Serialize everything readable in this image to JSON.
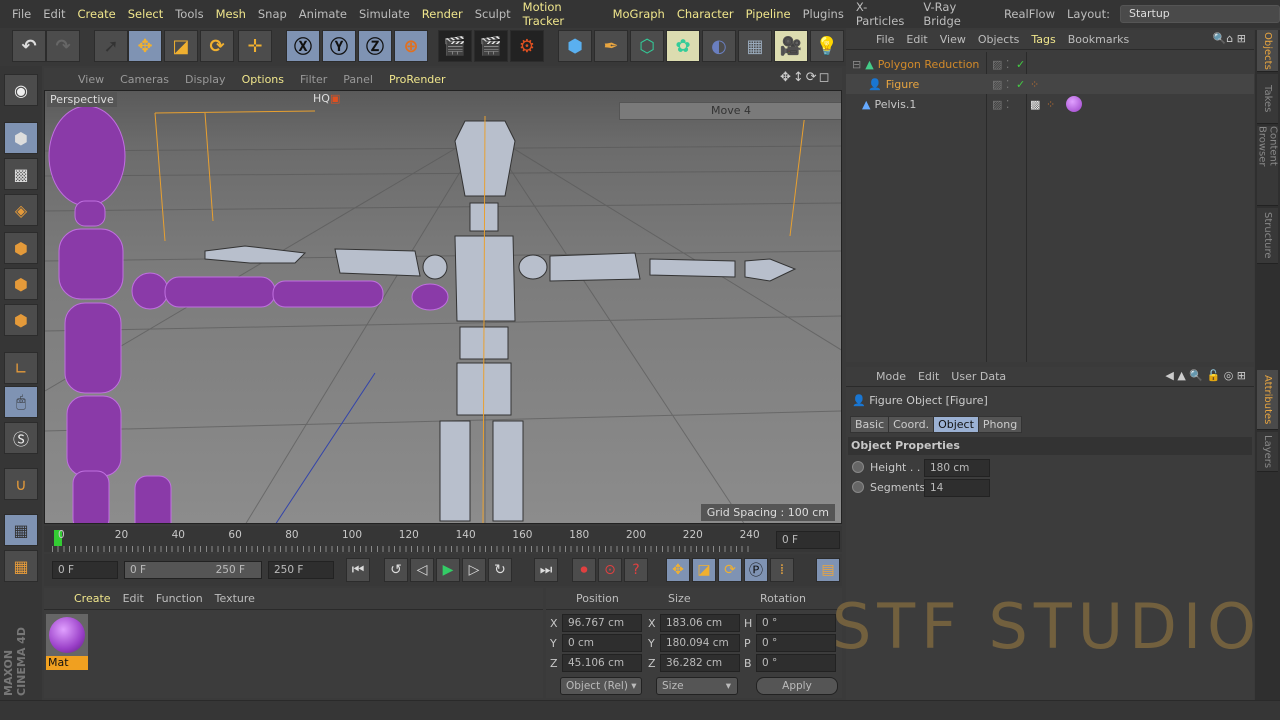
{
  "menubar": {
    "items": [
      "File",
      "Edit",
      "Create",
      "Select",
      "Tools",
      "Mesh",
      "Snap",
      "Animate",
      "Simulate",
      "Render",
      "Sculpt",
      "Motion Tracker",
      "MoGraph",
      "Character",
      "Pipeline",
      "Plugins",
      "X-Particles",
      "V-Ray Bridge",
      "RealFlow"
    ],
    "highlighted": [
      2,
      3,
      5,
      9,
      11,
      12,
      13,
      14
    ],
    "layout_label": "Layout:",
    "layout_value": "Startup"
  },
  "viewport": {
    "menu": [
      "View",
      "Cameras",
      "Display",
      "Options",
      "Filter",
      "Panel",
      "ProRender"
    ],
    "camera": "Perspective",
    "hq": "HQ",
    "move_hud": "Move 4",
    "grid_spacing": "Grid Spacing : 100 cm"
  },
  "timeline": {
    "ticks": [
      "0",
      "20",
      "40",
      "60",
      "80",
      "100",
      "120",
      "140",
      "160",
      "180",
      "200",
      "220",
      "240"
    ],
    "current": "0 F",
    "start": "0 F",
    "range_start": "0 F",
    "range_end": "250 F",
    "end": "250 F"
  },
  "materials": {
    "menu": [
      "Create",
      "Edit",
      "Function",
      "Texture"
    ],
    "items": [
      {
        "name": "Mat",
        "color": "#b15ee0"
      }
    ]
  },
  "coords": {
    "headers": [
      "Position",
      "Size",
      "Rotation"
    ],
    "rows": [
      {
        "pl": "X",
        "p": "96.767 cm",
        "sl": "X",
        "s": "183.06 cm",
        "rl": "H",
        "r": "0 °"
      },
      {
        "pl": "Y",
        "p": "0 cm",
        "sl": "Y",
        "s": "180.094 cm",
        "rl": "P",
        "r": "0 °"
      },
      {
        "pl": "Z",
        "p": "45.106 cm",
        "sl": "Z",
        "s": "36.282 cm",
        "rl": "B",
        "r": "0 °"
      }
    ],
    "mode": "Object (Rel)",
    "size_mode": "Size",
    "apply": "Apply"
  },
  "objects": {
    "menu": [
      "File",
      "Edit",
      "View",
      "Objects",
      "Tags",
      "Bookmarks"
    ],
    "items": [
      {
        "name": "Polygon Reduction",
        "color": "#d28a2a"
      },
      {
        "name": "Figure",
        "color": "#e8a540"
      },
      {
        "name": "Pelvis.1",
        "color": "#c8c8c8"
      }
    ]
  },
  "attributes": {
    "menu": [
      "Mode",
      "Edit",
      "User Data"
    ],
    "title": "Figure Object [Figure]",
    "tabs": [
      "Basic",
      "Coord.",
      "Object",
      "Phong"
    ],
    "active_tab": "Object",
    "section": "Object Properties",
    "props": [
      {
        "label": "Height . .",
        "value": "180 cm"
      },
      {
        "label": "Segments",
        "value": "14"
      }
    ]
  },
  "side_tabs": [
    "Objects",
    "Takes",
    "Content Browser",
    "Structure",
    "Attributes",
    "Layers"
  ],
  "branding": {
    "logo": "MAXON CINEMA 4D",
    "watermark": "STF STUDIO"
  }
}
